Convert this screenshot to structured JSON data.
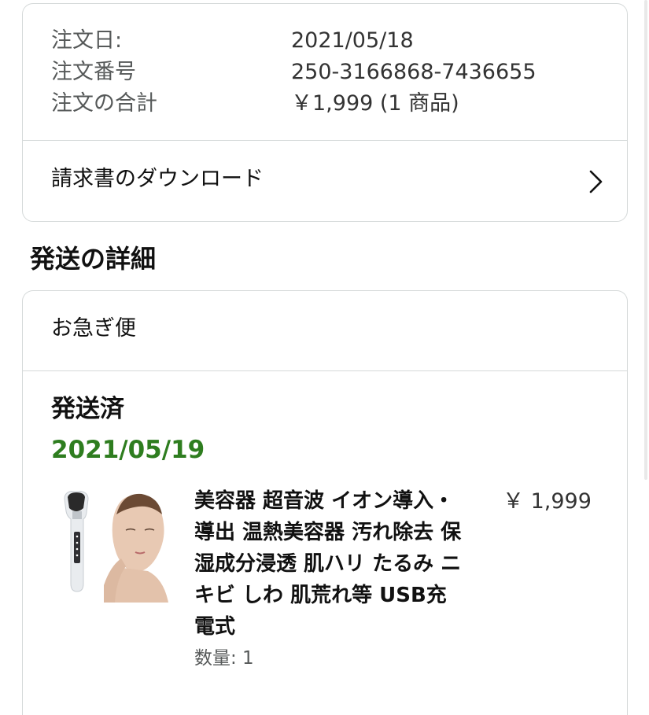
{
  "order_summary": {
    "order_date_label": "注文日:",
    "order_date_value": "2021/05/18",
    "order_number_label": "注文番号",
    "order_number_value": "250-3166868-7436655",
    "order_total_label": "注文の合計",
    "order_total_value": "￥1,999 (1 商品)"
  },
  "invoice": {
    "label": "請求書のダウンロード",
    "icon": "chevron-right-icon"
  },
  "shipping_section": {
    "title": "発送の詳細",
    "speed": "お急ぎ便",
    "status": "発送済",
    "status_date": "2021/05/19",
    "status_color": "#2e7d1f",
    "item": {
      "title": "美容器 超音波 イオン導入・導出 温熱美容器 汚れ除去 保湿成分浸透 肌ハリ たるみ ニキビ しわ 肌荒れ等 USB充電式",
      "price": "￥ 1,999",
      "quantity": "数量: 1",
      "image": "beauty-device-product-image"
    }
  }
}
